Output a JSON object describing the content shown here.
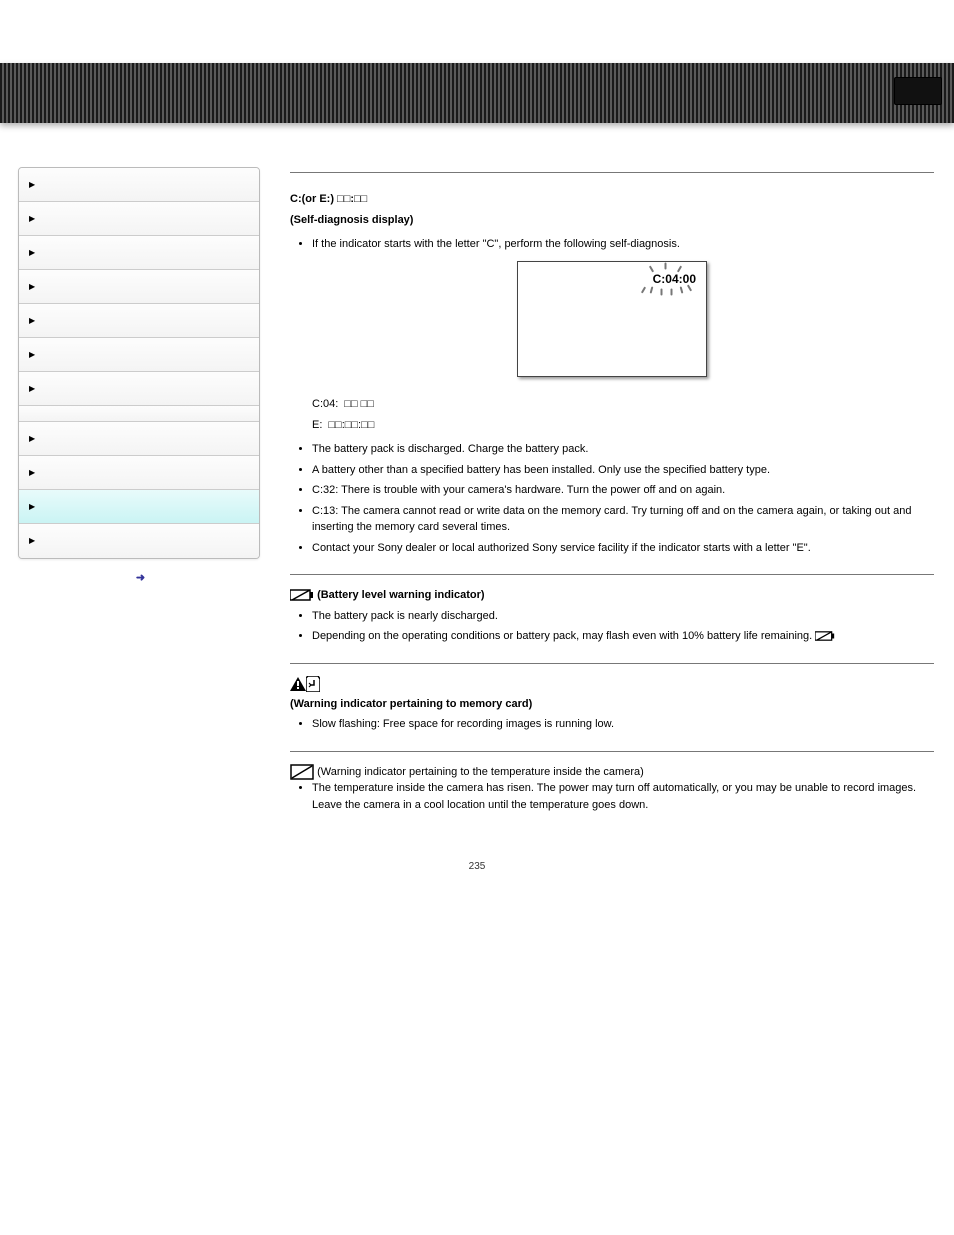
{
  "header": {},
  "sidebar": {
    "items": [
      {
        "label": ""
      },
      {
        "label": ""
      },
      {
        "label": ""
      },
      {
        "label": ""
      },
      {
        "label": ""
      },
      {
        "label": ""
      },
      {
        "label": ""
      },
      {
        "label": ""
      },
      {
        "label": ""
      },
      {
        "label": ""
      },
      {
        "label": ""
      }
    ],
    "back_next": ""
  },
  "main": {
    "title1": "",
    "title2": "",
    "section1": {
      "heading1": "C:(or E:) ",
      "heading_code": "C:04:00",
      "heading2": "(Self-diagnosis display)",
      "bullet1": "If the indicator starts with the letter \"C\", perform the following self-diagnosis.",
      "display_code": "C:04:00",
      "row1_pre": "C:04:",
      "row1_post": "",
      "row2_pre": "E:",
      "row2_post": "",
      "ul": [
        "The battery pack is discharged. Charge the battery pack.",
        "A battery other than a specified battery has been installed. Only use the specified battery type.",
        "C:32: There is trouble with your camera's hardware. Turn the power off and on again.",
        "C:13: The camera cannot read or write data on the memory card. Try turning off and on the camera again, or taking out and inserting the memory card several times.",
        "Contact your Sony dealer or local authorized Sony service facility if the indicator starts with a letter \"E\"."
      ]
    },
    "section2": {
      "icon_label": " (Battery level warning indicator)",
      "bullets": [
        "The battery pack is nearly discharged.",
        "Depending on the operating conditions or battery pack,  may flash even with 10% battery life remaining."
      ]
    },
    "section3": {
      "icon_label": " (Warning indicator pertaining to memory card)",
      "bullets": [
        "Slow flashing: Free space for recording images is running low."
      ]
    },
    "section4": {
      "icon_label": " (Warning indicator pertaining to the temperature inside the camera)",
      "bullets": [
        "The temperature inside the camera has risen. The power may turn off automatically, or you may be unable to record images. Leave the camera in a cool location until the temperature goes down."
      ]
    },
    "page_number": "235"
  }
}
